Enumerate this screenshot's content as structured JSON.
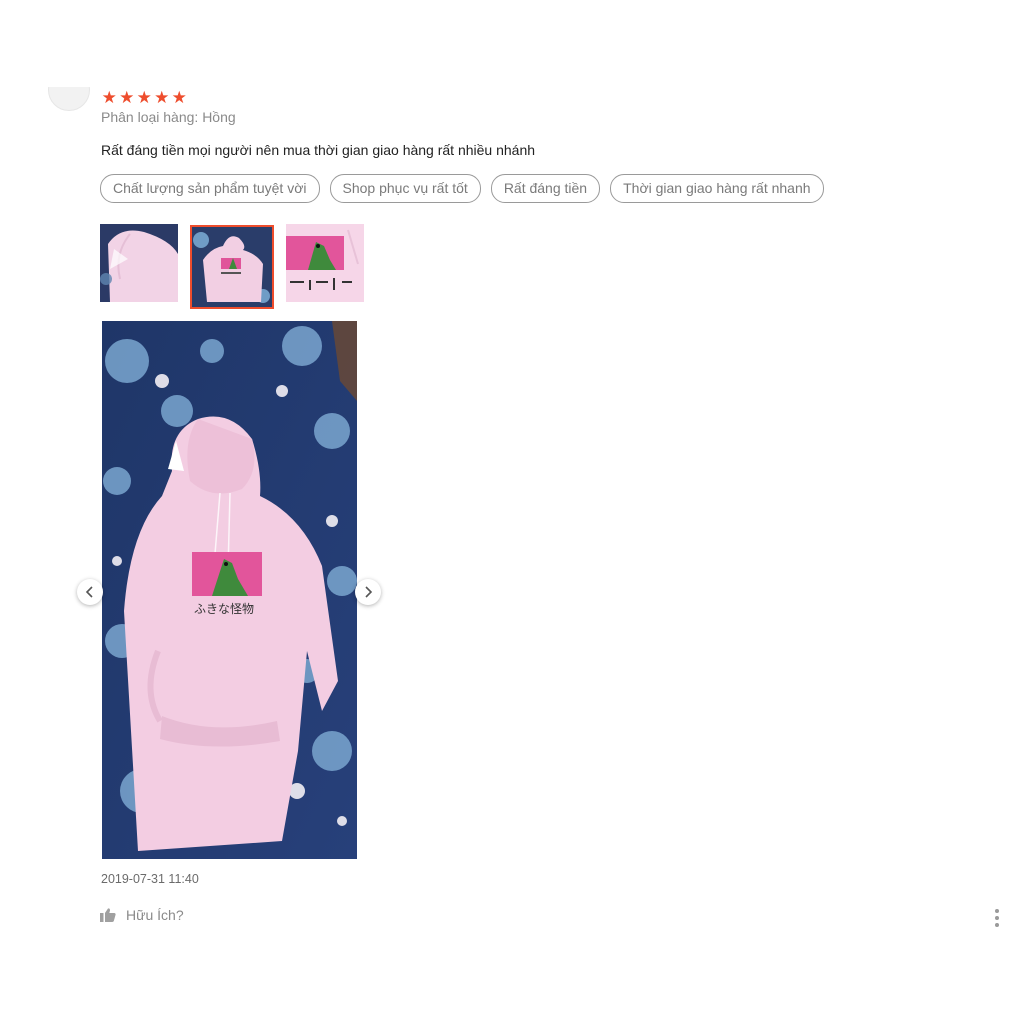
{
  "review": {
    "rating": 5,
    "stars": [
      "★",
      "★",
      "★",
      "★",
      "★"
    ],
    "variation": "Phân loại hàng: Hồng",
    "comment": "Rất đáng tiền mọi người nên mua thời gian giao hàng rất nhiều nhánh",
    "tags": [
      "Chất lượng sản phẩm tuyệt vời",
      "Shop phục vụ rất tốt",
      "Rất đáng tiền",
      "Thời gian giao hàng rất nhanh"
    ],
    "media": {
      "thumbnail_count": 3,
      "active_thumbnail": 2,
      "print_text": "ふきな怪物"
    },
    "timestamp": "2019-07-31 11:40",
    "helpful_label": "Hữu Ích?"
  },
  "icons": {
    "star": "star-icon",
    "prev": "chevron-left-icon",
    "next": "chevron-right-icon",
    "like": "thumbs-up-icon",
    "more": "vertical-dots-icon",
    "avatar": "user-avatar-icon"
  },
  "colors": {
    "accent": "#ee4d2d",
    "tag_border": "#9a9a9a",
    "muted_text": "#8a8a8a"
  }
}
